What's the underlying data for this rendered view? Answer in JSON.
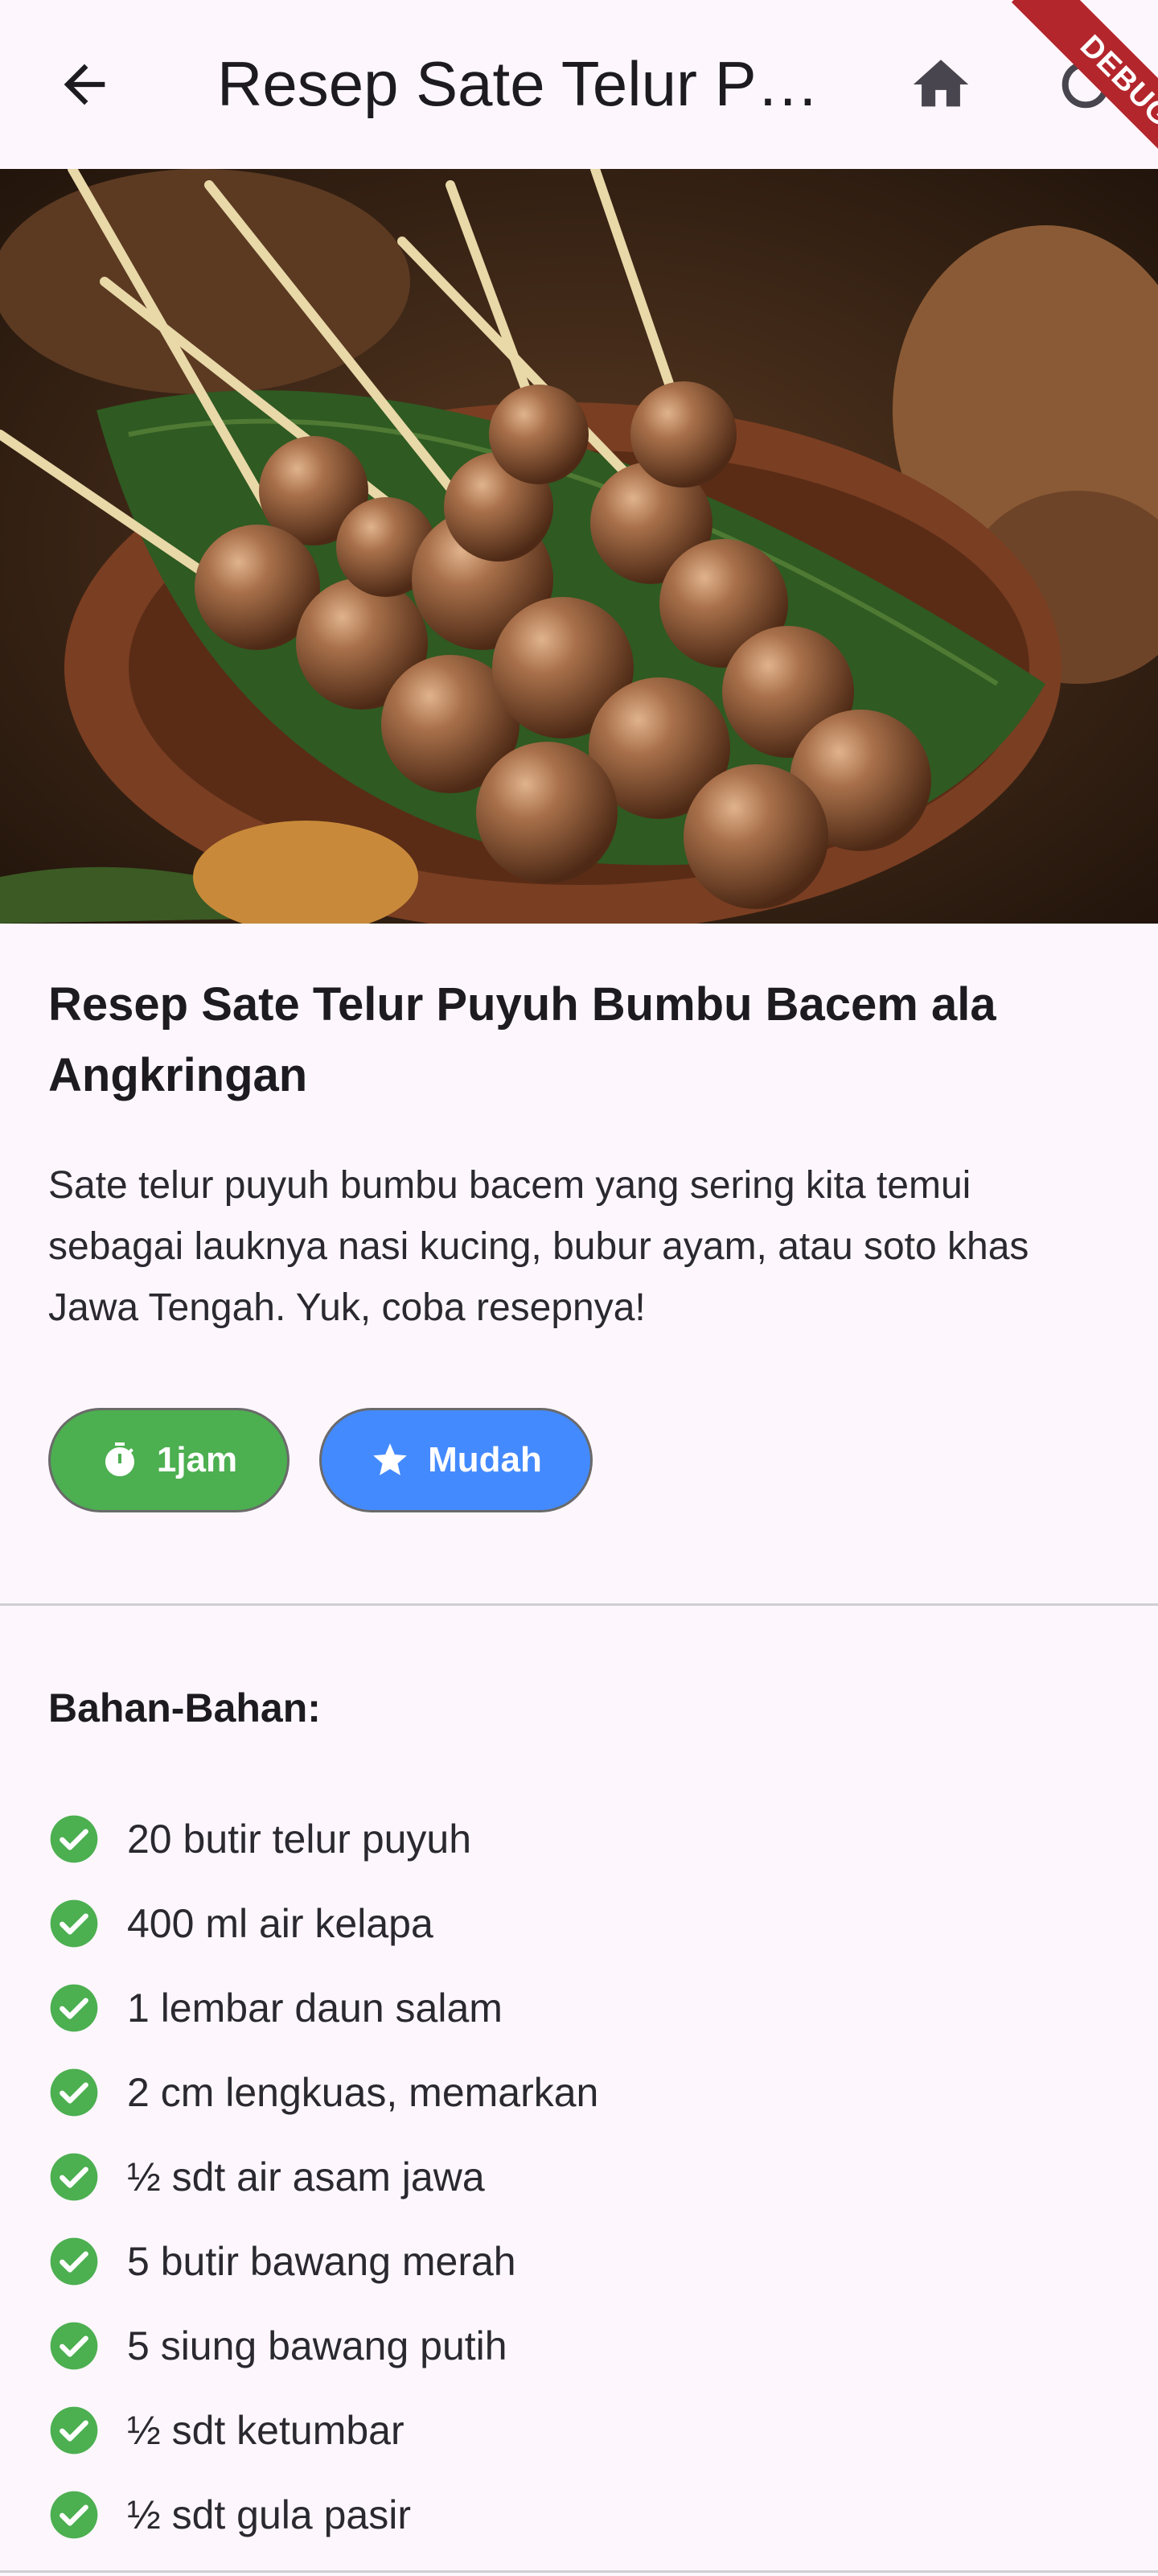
{
  "appbar": {
    "title": "Resep Sate Telur Puyuh Bumbu Bacem ala Angkringan",
    "back_icon": "arrow-back-icon",
    "home_icon": "home-icon",
    "debug_label": "DEBUG"
  },
  "hero": {
    "image_name": "sate-telur-puyuh-photo"
  },
  "recipe": {
    "title": "Resep Sate Telur Puyuh Bumbu Bacem ala Angkringan",
    "description": "Sate telur puyuh bumbu bacem yang sering kita temui sebagai lauknya nasi kucing, bubur ayam, atau soto khas Jawa Tengah. Yuk, coba resepnya!"
  },
  "chips": {
    "time": {
      "label": "1jam",
      "icon": "timer-icon",
      "color": "#4caf50"
    },
    "difficulty": {
      "label": "Mudah",
      "icon": "star-icon",
      "color": "#448aff"
    }
  },
  "ingredients": {
    "heading": "Bahan-Bahan:",
    "check_color": "#4caf50",
    "items": [
      "20 butir telur puyuh",
      "400 ml air kelapa",
      "1 lembar daun salam",
      "2 cm lengkuas, memarkan",
      "½ sdt air asam jawa",
      "5 butir bawang merah",
      "5 siung bawang putih",
      "½ sdt ketumbar",
      "½ sdt gula pasir"
    ]
  }
}
